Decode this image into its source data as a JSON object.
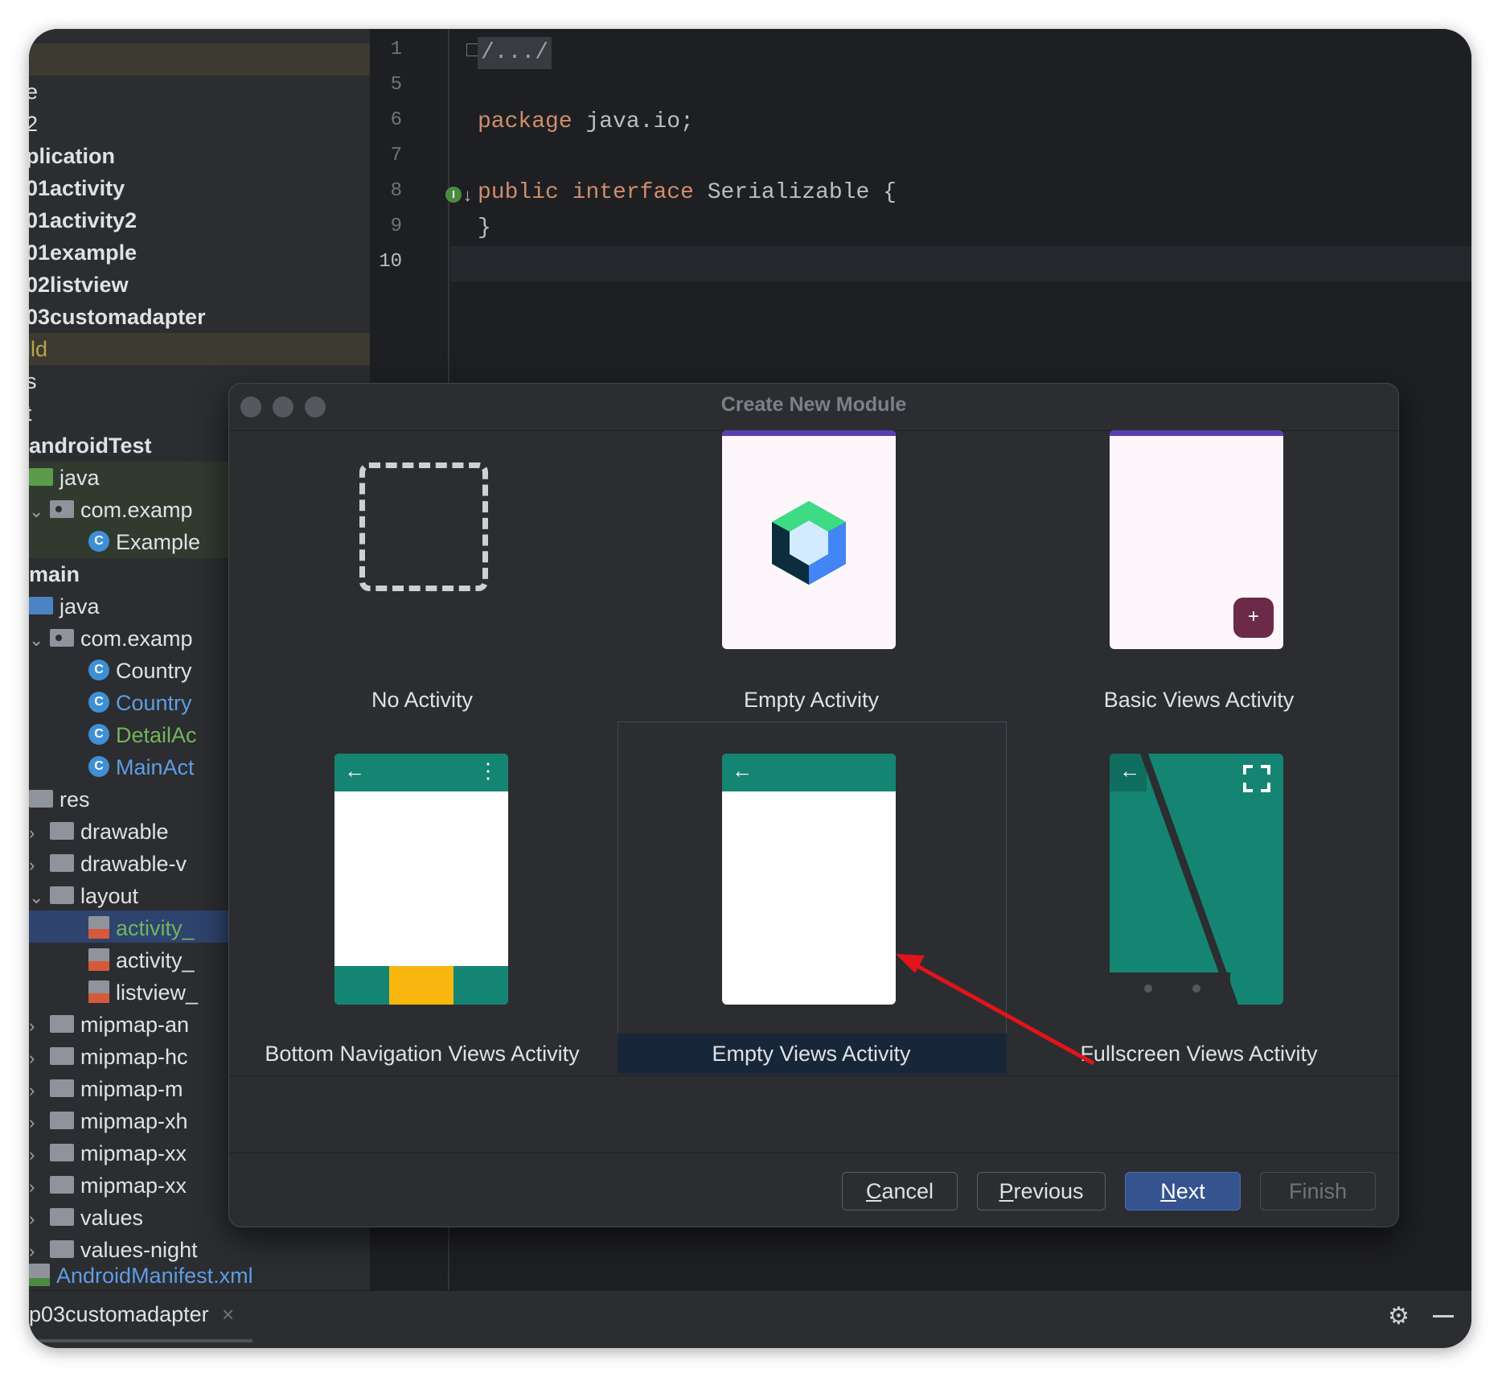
{
  "project_tree": {
    "top_items": [
      {
        "label": "e",
        "style": "plain"
      },
      {
        "label": "2",
        "style": "plain"
      },
      {
        "label": "plication",
        "style": "bold"
      },
      {
        "label": "01activity",
        "style": "bold"
      },
      {
        "label": "01activity2",
        "style": "bold"
      },
      {
        "label": "01example",
        "style": "bold"
      },
      {
        "label": "02listview",
        "style": "bold"
      },
      {
        "label": "03customadapter",
        "style": "bold"
      },
      {
        "label": "ild",
        "style": "yellow"
      },
      {
        "label": "s",
        "style": "plain"
      },
      {
        "label": "t",
        "style": "plain"
      }
    ],
    "android_test": "androidTest",
    "android_test_java": "java",
    "android_test_package": "com.examp",
    "android_test_class": "Example",
    "main": "main",
    "main_java": "java",
    "main_package": "com.examp",
    "classes": [
      "Country",
      "Country",
      "DetailAc",
      "MainAct"
    ],
    "res": "res",
    "drawable": "drawable",
    "drawable_v": "drawable-v",
    "layout": "layout",
    "layout_files": [
      "activity_",
      "activity_",
      "listview_"
    ],
    "mipmap_folders": [
      "mipmap-an",
      "mipmap-hc",
      "mipmap-m",
      "mipmap-xh",
      "mipmap-xx",
      "mipmap-xx"
    ],
    "values": "values",
    "values_night": "values-night",
    "manifest": "AndroidManifest.xml"
  },
  "editor": {
    "line_numbers": [
      "1",
      "5",
      "6",
      "7",
      "8",
      "9",
      "10"
    ],
    "folded": "/.../",
    "package_kw": "package",
    "package_name": "java.io;",
    "public_kw": "public",
    "interface_kw": "interface",
    "interface_decl": "Serializable {",
    "closing_brace": "}"
  },
  "bottom_bar": {
    "tab": "p03customadapter",
    "close": "×",
    "gear_icon": "⚙"
  },
  "dialog": {
    "title": "Create New Module",
    "templates": [
      {
        "label": "No Activity"
      },
      {
        "label": "Empty Activity"
      },
      {
        "label": "Basic Views Activity",
        "fab": "+"
      },
      {
        "label": "Bottom Navigation Views Activity"
      },
      {
        "label": "Empty Views Activity",
        "selected": true
      },
      {
        "label": "Fullscreen Views Activity"
      }
    ],
    "buttons": {
      "cancel": {
        "mnemonic": "C",
        "rest": "ancel"
      },
      "previous": {
        "mnemonic": "P",
        "rest": "revious"
      },
      "next": {
        "mnemonic": "N",
        "rest": "ext"
      },
      "finish": "Finish"
    },
    "colors": {
      "accent": "#148572",
      "nav_highlight": "#f9b710",
      "primary_button": "#35538e",
      "annotation_arrow": "#e0141a"
    }
  }
}
